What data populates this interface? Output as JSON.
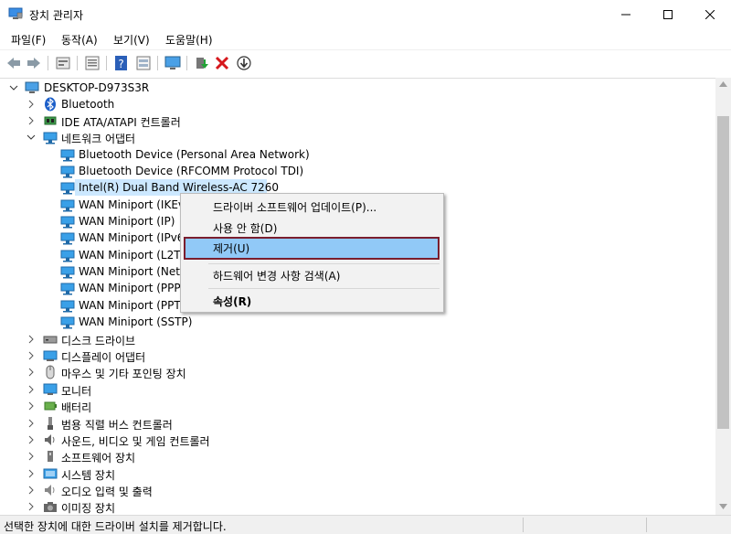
{
  "window": {
    "title": "장치 관리자",
    "icon": "device-manager-icon"
  },
  "menu": [
    "파일(F)",
    "동작(A)",
    "보기(V)",
    "도움말(H)"
  ],
  "toolbar": {
    "buttons": [
      "back-icon",
      "forward-icon",
      "properties-icon",
      "view-icon",
      "help-icon",
      "show-hidden-icon",
      "monitor-icon",
      "update-driver-icon",
      "uninstall-icon",
      "scan-icon"
    ]
  },
  "tree": {
    "root": "DESKTOP-D973S3R",
    "items": [
      {
        "label": "Bluetooth",
        "icon": "bluetooth-icon",
        "expanded": false
      },
      {
        "label": "IDE ATA/ATAPI 컨트롤러",
        "icon": "ide-controller-icon",
        "expanded": false
      },
      {
        "label": "네트워크 어댑터",
        "icon": "network-adapter-icon",
        "expanded": true,
        "children": [
          "Bluetooth Device (Personal Area Network)",
          "Bluetooth Device (RFCOMM Protocol TDI)",
          "Intel(R) Dual Band Wireless-AC 7260",
          "WAN Miniport (IKEv",
          "WAN Miniport (IP)",
          "WAN Miniport (IPv6",
          "WAN Miniport (L2TI",
          "WAN Miniport (Netv",
          "WAN Miniport (PPP",
          "WAN Miniport (PPTI",
          "WAN Miniport (SSTP)"
        ]
      },
      {
        "label": "디스크 드라이브",
        "icon": "disk-drive-icon",
        "expanded": false
      },
      {
        "label": "디스플레이 어댑터",
        "icon": "display-adapter-icon",
        "expanded": false
      },
      {
        "label": "마우스 및 기타 포인팅 장치",
        "icon": "mouse-icon",
        "expanded": false
      },
      {
        "label": "모니터",
        "icon": "monitor-icon",
        "expanded": false
      },
      {
        "label": "배터리",
        "icon": "battery-icon",
        "expanded": false
      },
      {
        "label": "범용 직렬 버스 컨트롤러",
        "icon": "usb-icon",
        "expanded": false
      },
      {
        "label": "사운드, 비디오 및 게임 컨트롤러",
        "icon": "sound-icon",
        "expanded": false
      },
      {
        "label": "소프트웨어 장치",
        "icon": "software-device-icon",
        "expanded": false
      },
      {
        "label": "시스템 장치",
        "icon": "system-device-icon",
        "expanded": false
      },
      {
        "label": "오디오 입력 및 출력",
        "icon": "audio-io-icon",
        "expanded": false
      },
      {
        "label": "이미징 장치",
        "icon": "imaging-device-icon",
        "expanded": false
      }
    ]
  },
  "context_menu": {
    "items": [
      {
        "label": "드라이버 소프트웨어 업데이트(P)...",
        "bold": false
      },
      {
        "label": "사용 안 함(D)",
        "bold": false
      },
      {
        "label": "제거(U)",
        "bold": false,
        "highlighted": true
      },
      {
        "label": "하드웨어 변경 사항 검색(A)",
        "bold": false
      },
      {
        "label": "속성(R)",
        "bold": true
      }
    ],
    "highlight_color": "#91c9f7",
    "highlight_border": "#7a1e2e"
  },
  "status": {
    "text": "선택한 장치에 대한 드라이버 설치를 제거합니다."
  }
}
